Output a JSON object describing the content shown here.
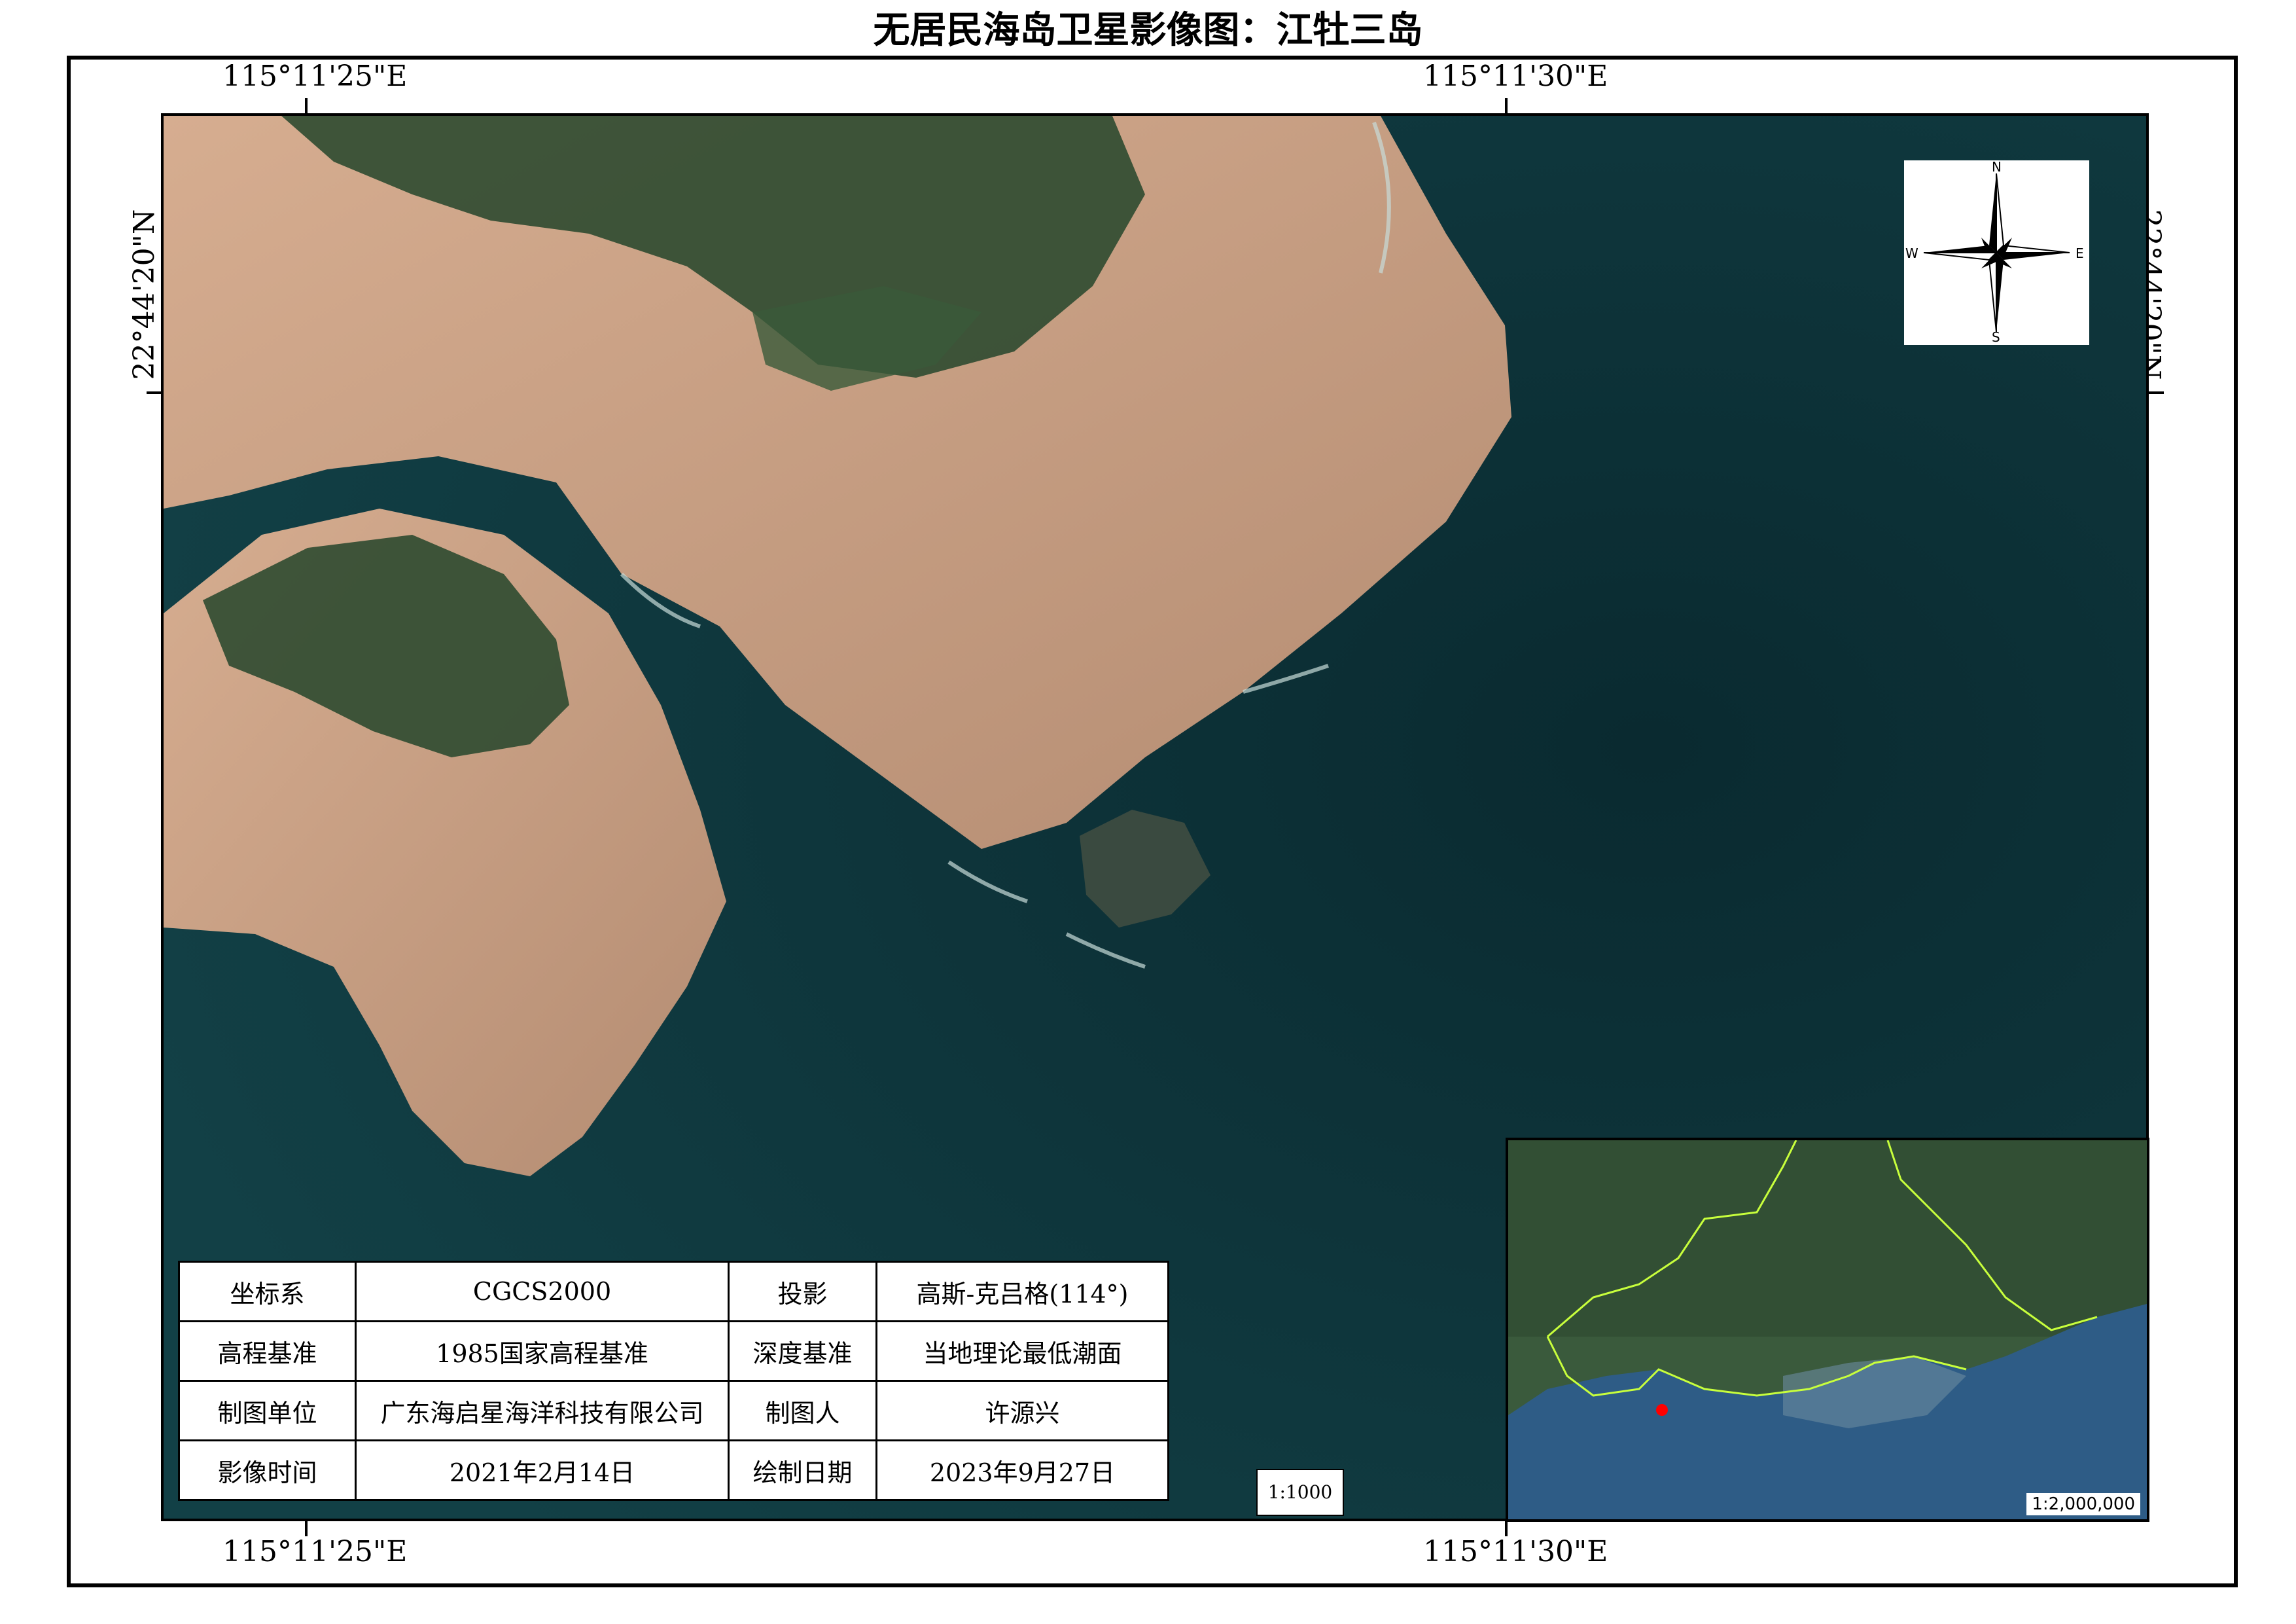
{
  "title": "无居民海岛卫星影像图：江牡三岛",
  "coords": {
    "lon_left": "115°11'25\"E",
    "lon_right": "115°11'30\"E",
    "lat": "22°44'20\"N"
  },
  "compass": {
    "n": "N",
    "s": "S",
    "e": "E",
    "w": "W"
  },
  "info": {
    "rows": [
      [
        "坐标系",
        "CGCS2000",
        "投影",
        "高斯-克吕格(114°)"
      ],
      [
        "高程基准",
        "1985国家高程基准",
        "深度基准",
        "当地理论最低潮面"
      ],
      [
        "制图单位",
        "广东海启星海洋科技有限公司",
        "制图人",
        "许源兴"
      ],
      [
        "影像时间",
        "2021年2月14日",
        "绘制日期",
        "2023年9月27日"
      ]
    ]
  },
  "scale": "1:1000",
  "inset": {
    "scale": "1:2,000,000",
    "boundary_color": "#c8ff3c",
    "marker_color": "#ff0000"
  },
  "colors": {
    "sea": "#0d3238",
    "rock": "#c9a083",
    "vegetation": "#2e4a30"
  }
}
